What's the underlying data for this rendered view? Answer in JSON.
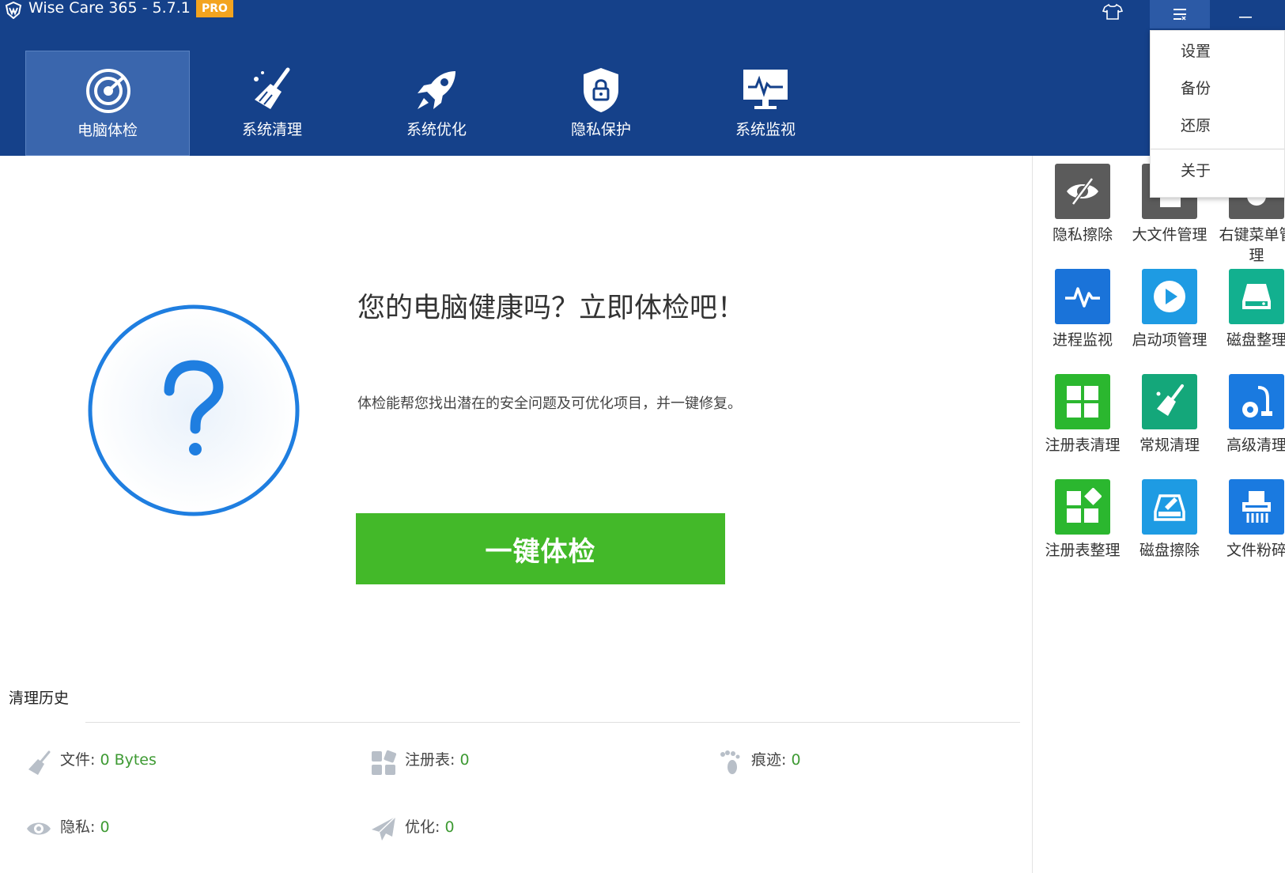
{
  "titlebar": {
    "title": "Wise Care 365 - 5.7.1",
    "badge": "PRO"
  },
  "nav": [
    {
      "label": "电脑体检",
      "icon": "radar-icon",
      "active": true
    },
    {
      "label": "系统清理",
      "icon": "broom-icon"
    },
    {
      "label": "系统优化",
      "icon": "rocket-icon"
    },
    {
      "label": "隐私保护",
      "icon": "shield-lock-icon"
    },
    {
      "label": "系统监视",
      "icon": "monitor-icon"
    }
  ],
  "menu": {
    "items": [
      "设置",
      "备份",
      "还原",
      "关于"
    ]
  },
  "main": {
    "headline": "您的电脑健康吗？立即体检吧！",
    "subtext": "体检能帮您找出潜在的安全问题及可优化项目，并一键修复。",
    "button": "一键体检"
  },
  "history": {
    "title": "清理历史",
    "files": {
      "label": "文件:",
      "value": "0 Bytes"
    },
    "registry": {
      "label": "注册表:",
      "value": "0"
    },
    "traces": {
      "label": "痕迹:",
      "value": "0"
    },
    "privacy": {
      "label": "隐私:",
      "value": "0"
    },
    "optimize": {
      "label": "优化:",
      "value": "0"
    }
  },
  "tools": [
    {
      "label": "隐私擦除",
      "icon": "eye-slash-icon",
      "color": "#5b5b5b"
    },
    {
      "label": "大文件管理",
      "icon": "file-icon",
      "color": "#5b5b5b"
    },
    {
      "label": "右键菜单管理",
      "icon": "mouse-icon",
      "color": "#5b5b5b"
    },
    {
      "label": "进程监视",
      "icon": "pulse-icon",
      "color": "#1a73d9"
    },
    {
      "label": "启动项管理",
      "icon": "play-icon",
      "color": "#1e9be3"
    },
    {
      "label": "磁盘整理",
      "icon": "disk-icon",
      "color": "#12b08f"
    },
    {
      "label": "注册表清理",
      "icon": "grid-icon",
      "color": "#2bb72f"
    },
    {
      "label": "常规清理",
      "icon": "broom-icon",
      "color": "#14a77a"
    },
    {
      "label": "高级清理",
      "icon": "vacuum-icon",
      "color": "#1a7ae0"
    },
    {
      "label": "注册表整理",
      "icon": "registry-defrag-icon",
      "color": "#2bb72f"
    },
    {
      "label": "磁盘擦除",
      "icon": "disk-erase-icon",
      "color": "#1e9be3"
    },
    {
      "label": "文件粉碎",
      "icon": "shredder-icon",
      "color": "#1a7ae0"
    }
  ],
  "colors": {
    "header": "#15418a",
    "accent_green": "#43b929",
    "value_green": "#3e9a33",
    "circle_blue": "#1f7ee0"
  }
}
